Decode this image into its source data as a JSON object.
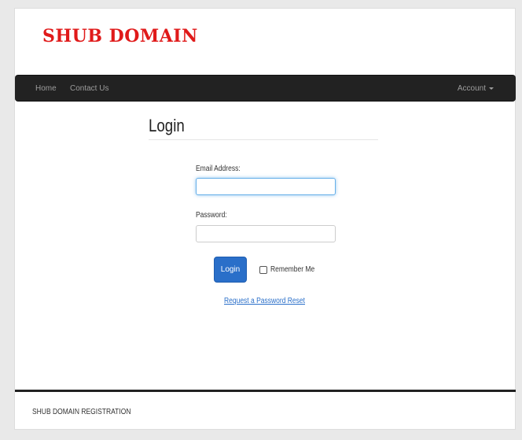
{
  "brand": {
    "name": "SHUB DOMAIN",
    "color": "#e01a1a"
  },
  "navbar": {
    "items": [
      {
        "label": "Home"
      },
      {
        "label": "Contact Us"
      }
    ],
    "account_label": "Account"
  },
  "login": {
    "title": "Login",
    "email_label": "Email Address:",
    "email_value": "",
    "password_label": "Password:",
    "password_value": "",
    "submit_label": "Login",
    "remember_label": "Remember Me",
    "remember_checked": false,
    "reset_link": "Request a Password Reset"
  },
  "footer": {
    "text": "SHUB DOMAIN REGISTRATION"
  },
  "colors": {
    "primary": "#2a6fc9",
    "navbar": "#222222"
  }
}
